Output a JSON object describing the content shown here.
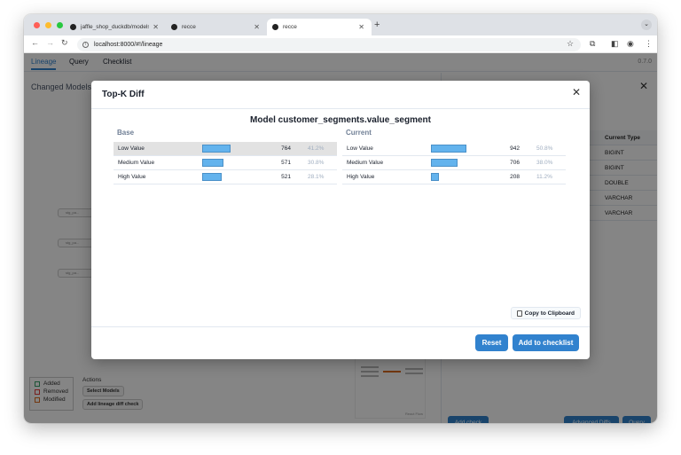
{
  "browser": {
    "tabs": [
      {
        "title": "jaffle_shop_duckdb/models/..."
      },
      {
        "title": "recce"
      },
      {
        "title": "recce"
      }
    ],
    "new_tab": "+",
    "url": "localhost:8000/#!/lineage"
  },
  "app": {
    "nav": [
      "Lineage",
      "Query",
      "Checklist"
    ],
    "version": "0.7.0"
  },
  "background": {
    "left_title": "Changed Models",
    "nodes": [
      "stg_pa...",
      "stg_pa...",
      "stg_pa..."
    ],
    "legend": [
      "Added",
      "Removed",
      "Modified"
    ],
    "actions_title": "Actions",
    "select_models": "Select Models",
    "add_lineage_check": "Add lineage diff check",
    "minimap_label": "React Flow",
    "table_header": [
      "pe",
      "Current Type"
    ],
    "table_rows": [
      [
        "",
        "BIGINT"
      ],
      [
        "",
        "BIGINT"
      ],
      [
        "",
        "DOUBLE"
      ],
      [
        "R",
        "VARCHAR"
      ],
      [
        "R",
        "VARCHAR"
      ]
    ],
    "add_check": "Add check",
    "advanced_diffs": "Advanced Diffs",
    "query": "Query"
  },
  "modal": {
    "title": "Top-K Diff",
    "subtitle": "Model customer_segments.value_segment",
    "base_label": "Base",
    "current_label": "Current",
    "copy_label": "Copy to Clipboard",
    "reset_label": "Reset",
    "add_label": "Add to checklist"
  },
  "chart_data": [
    {
      "type": "bar",
      "title": "Base",
      "categories": [
        "Low Value",
        "Medium Value",
        "High Value"
      ],
      "values": [
        764,
        571,
        521
      ],
      "percent_labels": [
        "41.2%",
        "30.8%",
        "28.1%"
      ]
    },
    {
      "type": "bar",
      "title": "Current",
      "categories": [
        "Low Value",
        "Medium Value",
        "High Value"
      ],
      "values": [
        942,
        706,
        208
      ],
      "percent_labels": [
        "50.8%",
        "38.0%",
        "11.2%"
      ]
    }
  ],
  "colors": {
    "accent": "#3182ce",
    "bar": "#63b3ed",
    "added": "#38a169",
    "removed": "#e53e3e",
    "modified": "#dd6b20"
  }
}
